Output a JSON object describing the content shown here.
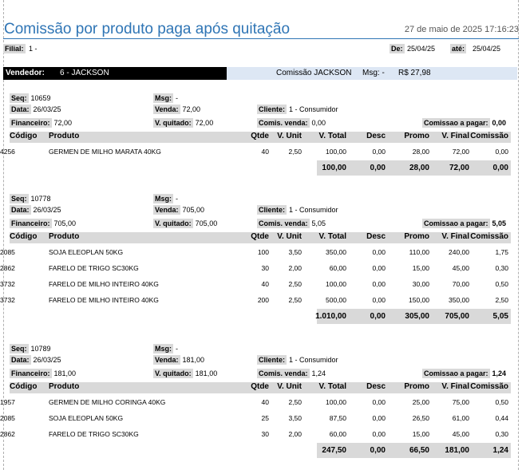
{
  "header": {
    "title": "Comissão por produto paga após quitação",
    "datetime": "27 de maio de 2025 17:16:23",
    "filial_label": "Filial:",
    "filial_value": "1 -",
    "de_label": "De:",
    "de_value": "25/04/25",
    "ate_label": "até:",
    "ate_value": "25/04/25"
  },
  "vendedor": {
    "label": "Vendedor:",
    "value": "6 - JACKSON",
    "comissao_text": "Comissão JACKSON",
    "msg_text": "Msg: -",
    "comissao_value": "R$ 27,98"
  },
  "labels": {
    "seq": "Seq:",
    "msg": "Msg:",
    "data": "Data:",
    "venda": "Venda:",
    "cliente": "Cliente:",
    "financeiro": "Financeiro:",
    "v_quitado": "V. quitado:",
    "comis_venda": "Comis. venda:",
    "comissao_pagar": "Comissao a pagar:"
  },
  "columns": [
    "Código",
    "Produto",
    "Qtde",
    "V. Unit",
    "V. Total",
    "Desc",
    "Promo",
    "V. Final",
    "Comissão"
  ],
  "orders": [
    {
      "seq": "10659",
      "msg": "-",
      "data": "26/03/25",
      "venda": "72,00",
      "cliente": "1 - Consumidor",
      "financeiro": "72,00",
      "v_quitado": "72,00",
      "comis_venda": "0,00",
      "comissao_pagar": "0,00",
      "rows": [
        [
          "4256",
          "GERMEN DE MILHO MARATA 40KG",
          "40",
          "2,50",
          "100,00",
          "0,00",
          "28,00",
          "72,00",
          "0,00"
        ]
      ],
      "totals": [
        "100,00",
        "0,00",
        "28,00",
        "72,00",
        "0,00"
      ]
    },
    {
      "seq": "10778",
      "msg": "-",
      "data": "26/03/25",
      "venda": "705,00",
      "cliente": "1 - Consumidor",
      "financeiro": "705,00",
      "v_quitado": "705,00",
      "comis_venda": "5,05",
      "comissao_pagar": "5,05",
      "rows": [
        [
          "2085",
          "SOJA ELEOPLAN 50KG",
          "100",
          "3,50",
          "350,00",
          "0,00",
          "110,00",
          "240,00",
          "1,75"
        ],
        [
          "2862",
          "FARELO DE TRIGO SC30KG",
          "30",
          "2,00",
          "60,00",
          "0,00",
          "15,00",
          "45,00",
          "0,30"
        ],
        [
          "3732",
          "FARELO DE MILHO INTEIRO 40KG",
          "40",
          "2,50",
          "100,00",
          "0,00",
          "30,00",
          "70,00",
          "0,50"
        ],
        [
          "3732",
          "FARELO DE MILHO INTEIRO 40KG",
          "200",
          "2,50",
          "500,00",
          "0,00",
          "150,00",
          "350,00",
          "2,50"
        ]
      ],
      "totals": [
        "1.010,00",
        "0,00",
        "305,00",
        "705,00",
        "5,05"
      ]
    },
    {
      "seq": "10789",
      "msg": "-",
      "data": "26/03/25",
      "venda": "181,00",
      "cliente": "1 - Consumidor",
      "financeiro": "181,00",
      "v_quitado": "181,00",
      "comis_venda": "1,24",
      "comissao_pagar": "1,24",
      "rows": [
        [
          "1957",
          "GERMEN DE MILHO CORINGA 40KG",
          "40",
          "2,50",
          "100,00",
          "0,00",
          "25,00",
          "75,00",
          "0,50"
        ],
        [
          "2085",
          "SOJA ELEOPLAN 50KG",
          "25",
          "3,50",
          "87,50",
          "0,00",
          "26,50",
          "61,00",
          "0,44"
        ],
        [
          "2862",
          "FARELO DE TRIGO SC30KG",
          "30",
          "2,00",
          "60,00",
          "0,00",
          "15,00",
          "45,00",
          "0,30"
        ]
      ],
      "totals": [
        "247,50",
        "0,00",
        "66,50",
        "181,00",
        "1,24"
      ]
    }
  ]
}
